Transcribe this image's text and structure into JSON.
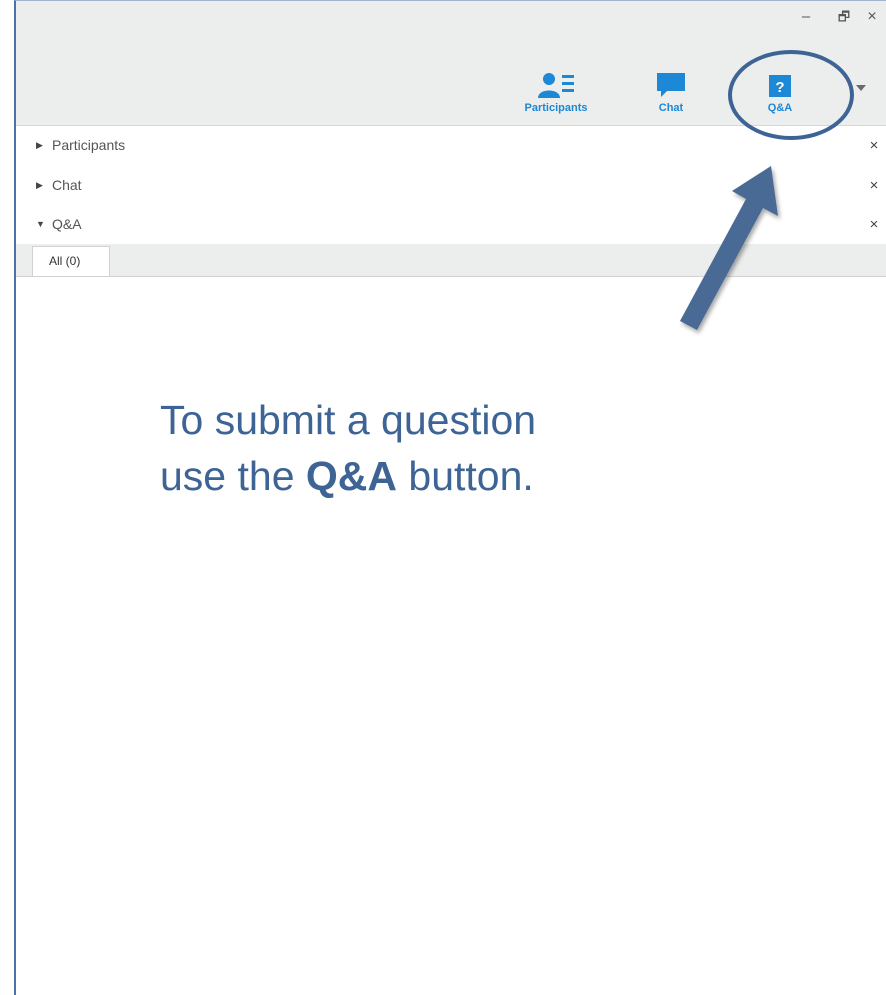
{
  "window": {
    "minimize": "–",
    "restore": "🗗",
    "close": "×"
  },
  "toolbar": {
    "participants_label": "Participants",
    "chat_label": "Chat",
    "qa_label": "Q&A",
    "qa_glyph": "?"
  },
  "panels": [
    {
      "label": "Participants",
      "state": "collapsed",
      "close": "×"
    },
    {
      "label": "Chat",
      "state": "collapsed",
      "close": "×"
    },
    {
      "label": "Q&A",
      "state": "expanded",
      "close": "×"
    }
  ],
  "qa": {
    "tabs": [
      {
        "label": "All (0)"
      }
    ]
  },
  "caption": {
    "line1": "To submit a question",
    "line2_pre": "use the ",
    "line2_bold": "Q&A",
    "line2_post": " button."
  },
  "colors": {
    "accent": "#1c88d6",
    "callout": "#3d6494"
  }
}
